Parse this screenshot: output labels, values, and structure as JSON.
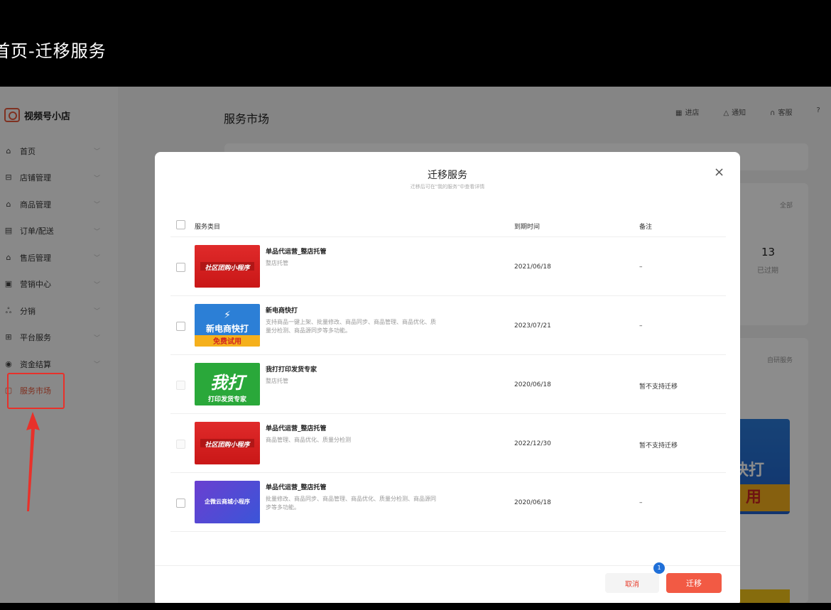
{
  "page_title": "首页-迁移服务",
  "sidebar": {
    "brand": "视频号小店",
    "items": [
      {
        "icon": "home-icon",
        "glyph": "⌂",
        "label": "首页"
      },
      {
        "icon": "store-icon",
        "glyph": "⊟",
        "label": "店铺管理"
      },
      {
        "icon": "bag-icon",
        "glyph": "⌂",
        "label": "商品管理"
      },
      {
        "icon": "order-icon",
        "glyph": "▤",
        "label": "订单/配送"
      },
      {
        "icon": "aftersale-icon",
        "glyph": "⌂",
        "label": "售后管理"
      },
      {
        "icon": "marketing-icon",
        "glyph": "▣",
        "label": "营销中心"
      },
      {
        "icon": "share-icon",
        "glyph": "ஃ",
        "label": "分销"
      },
      {
        "icon": "platform-icon",
        "glyph": "⊞",
        "label": "平台服务"
      },
      {
        "icon": "coin-icon",
        "glyph": "◉",
        "label": "资金结算"
      },
      {
        "icon": "market-icon",
        "glyph": "▢",
        "label": "服务市场"
      }
    ]
  },
  "header": {
    "title": "服务市场",
    "tools": [
      {
        "icon": "qrcode-icon",
        "glyph": "▦",
        "label": "进店"
      },
      {
        "icon": "bell-icon",
        "glyph": "△",
        "label": "通知"
      },
      {
        "icon": "headset-icon",
        "glyph": "∩",
        "label": "客服"
      }
    ],
    "help_glyph": "?"
  },
  "background": {
    "all_link": "全部",
    "stat_value": "13",
    "stat_label": "已过期",
    "self_link": "自研服务",
    "card_text": "快打",
    "card_badge": "用"
  },
  "modal": {
    "title": "迁移服务",
    "subtitle": "迁移后可在\"我的服务\"中查看详情",
    "close_glyph": "×",
    "columns": {
      "category": "服务类目",
      "expiry": "到期时间",
      "note": "备注"
    },
    "rows": [
      {
        "name": "单品代运营_整店托管",
        "desc": "整店托管",
        "date": "2021/06/18",
        "note": "–",
        "thumb_text": "社区团购小程序",
        "thumb_style": "red",
        "disabled": false
      },
      {
        "name": "新电商快打",
        "desc": "支持商品一键上架、批量修改、商品同步、商品管理、商品优化、质量分检测、商品源同步等多功能。",
        "date": "2023/07/21",
        "note": "–",
        "thumb_text": "新电商快打",
        "thumb_sub": "免费试用",
        "thumb_style": "blue",
        "disabled": false
      },
      {
        "name": "我打打印发货专家",
        "desc": "整店托管",
        "date": "2020/06/18",
        "note": "暂不支持迁移",
        "thumb_text": "我打",
        "thumb_sub": "打印发货专家",
        "thumb_style": "green",
        "disabled": true
      },
      {
        "name": "单品代运营_整店托管",
        "desc": "商品管理、商品优化、质量分检测",
        "date": "2022/12/30",
        "note": "暂不支持迁移",
        "thumb_text": "社区团购小程序",
        "thumb_style": "red",
        "disabled": true
      },
      {
        "name": "单品代运营_整店托管",
        "desc": "批量修改、商品同步、商品管理、商品优化、质量分检测、商品源同步等多功能。",
        "date": "2020/06/18",
        "note": "–",
        "thumb_text": "企微云商城小程序",
        "thumb_style": "purple",
        "disabled": false
      }
    ],
    "cancel_label": "取消",
    "migrate_label": "迁移",
    "badge_count": "1"
  },
  "colors": {
    "accent": "#f25a44",
    "annotation_red": "#e8312a",
    "badge_blue": "#1f6fd8"
  }
}
